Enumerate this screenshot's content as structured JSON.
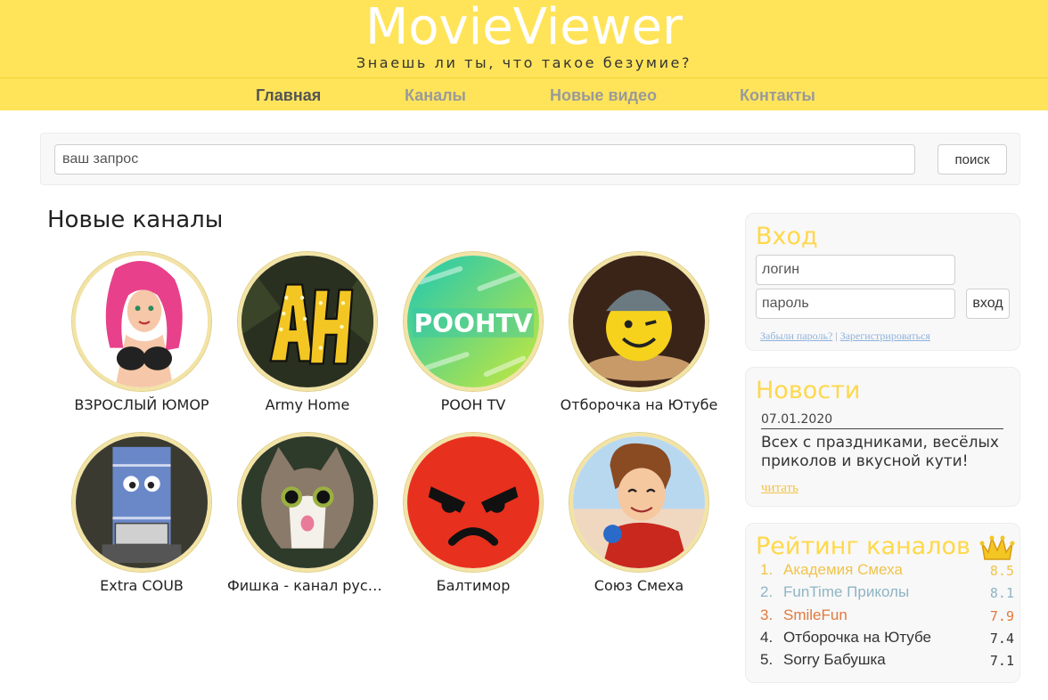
{
  "site": {
    "title": "MovieViewer",
    "tagline": "Знаешь ли ты, что такое безумие?"
  },
  "nav": [
    {
      "label": "Главная",
      "active": true
    },
    {
      "label": "Каналы",
      "active": false
    },
    {
      "label": "Новые видео",
      "active": false
    },
    {
      "label": "Контакты",
      "active": false
    }
  ],
  "search": {
    "placeholder": "ваш запрос",
    "button": "поиск"
  },
  "channels": {
    "title": "Новые каналы",
    "items": [
      {
        "name": "ВЗРОСЛЫЙ ЮМОР",
        "icon": "anime-girl-avatar"
      },
      {
        "name": "Army Home",
        "icon": "ah-marquee-letters-avatar"
      },
      {
        "name": "POOH TV",
        "icon": "poohtv-logo-avatar"
      },
      {
        "name": "Отборочка на Ютубе",
        "icon": "winking-emoji-avatar"
      },
      {
        "name": "Extra COUB",
        "icon": "towelie-avatar"
      },
      {
        "name": "Фишка - канал русс...",
        "icon": "surprised-cat-avatar"
      },
      {
        "name": "Балтимор",
        "icon": "angry-red-face-avatar"
      },
      {
        "name": "Союз Смеха",
        "icon": "cartoon-guy-avatar"
      }
    ]
  },
  "login": {
    "title": "Вход",
    "login_placeholder": "логин",
    "password_placeholder": "пароль",
    "button": "вход",
    "forgot": "Забыли пароль?",
    "separator": "|",
    "register": "Зарегистрироваться"
  },
  "news": {
    "title": "Новости",
    "date": "07.01.2020",
    "text": "Всех с праздниками, весёлых приколов и вкусной кути!",
    "link": "читать"
  },
  "rating": {
    "title": "Рейтинг каналов",
    "icon": "crown-icon",
    "items": [
      {
        "num": "1.",
        "name": "Академия Смеха",
        "score": "8.5",
        "color": "#f0c44a"
      },
      {
        "num": "2.",
        "name": "FunTime Приколы",
        "score": "8.1",
        "color": "#8fb4c4"
      },
      {
        "num": "3.",
        "name": "SmileFun",
        "score": "7.9",
        "color": "#e07a3c"
      },
      {
        "num": "4.",
        "name": "Отборочка на Ютубе",
        "score": "7.4",
        "color": "#333333"
      },
      {
        "num": "5.",
        "name": "Sorry Бабушка",
        "score": "7.1",
        "color": "#333333"
      }
    ]
  },
  "colors": {
    "brand_yellow": "#ffe45a",
    "panel_title": "#ffd84a"
  }
}
